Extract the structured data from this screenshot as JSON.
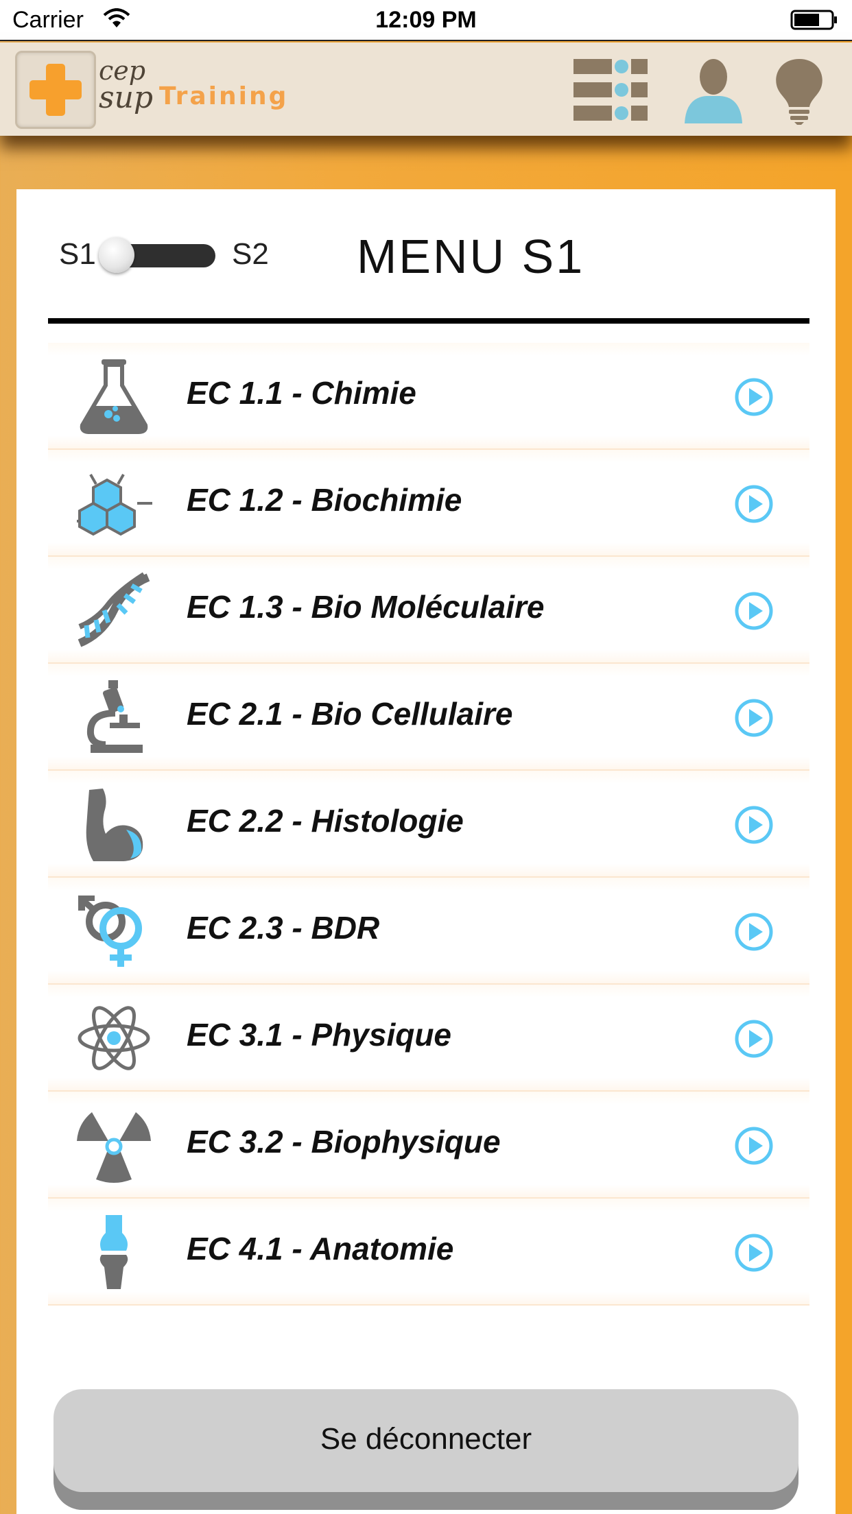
{
  "status_bar": {
    "carrier": "Carrier",
    "time": "12:09 PM",
    "icons": [
      "wifi-icon",
      "battery-icon"
    ]
  },
  "header": {
    "logo": {
      "line1": "cep",
      "line2": "sup",
      "word": "Training"
    },
    "buttons": [
      "list-view-icon",
      "profile-icon",
      "lightbulb-icon"
    ],
    "colors": {
      "header_bg": "#ede3d4",
      "logo_orange": "#f4a24a",
      "icon_brown": "#8c7a63",
      "icon_blue": "#7cc7dc"
    }
  },
  "semester_toggle": {
    "left_label": "S1",
    "right_label": "S2",
    "selected": "S1"
  },
  "menu": {
    "title": "MENU S1",
    "items": [
      {
        "label": "EC 1.1 - Chimie",
        "icon": "flask-icon"
      },
      {
        "label": "EC 1.2 - Biochimie",
        "icon": "molecule-icon"
      },
      {
        "label": "EC 1.3 - Bio Moléculaire",
        "icon": "dna-icon"
      },
      {
        "label": "EC 2.1 - Bio Cellulaire",
        "icon": "microscope-icon"
      },
      {
        "label": "EC 2.2 - Histologie",
        "icon": "arm-muscle-icon"
      },
      {
        "label": "EC 2.3 - BDR",
        "icon": "gender-symbols-icon"
      },
      {
        "label": "EC 3.1 - Physique",
        "icon": "atom-icon"
      },
      {
        "label": "EC 3.2 - Biophysique",
        "icon": "radiation-icon"
      },
      {
        "label": "EC 4.1 - Anatomie",
        "icon": "bone-joint-icon"
      }
    ],
    "accent_blue": "#5ac8f5"
  },
  "logout_button": {
    "label": "Se déconnecter"
  }
}
